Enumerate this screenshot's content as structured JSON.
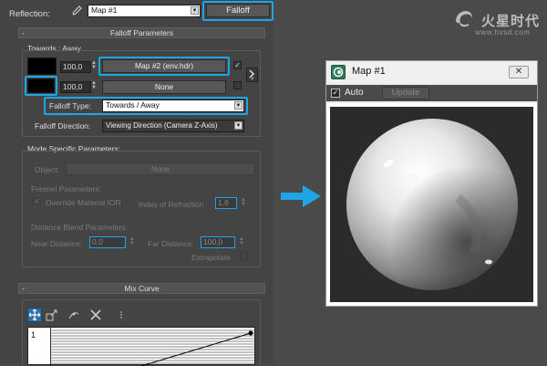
{
  "reflection": {
    "label": "Reflection:",
    "map_select": "Map #1",
    "falloff_button": "Falloff"
  },
  "falloff_params": {
    "rollout_title": "Falloff Parameters",
    "group_label": "Towards : Away",
    "row1_value": "100,0",
    "row1_map": "Map #2 (env.hdr)",
    "row1_checked": "✓",
    "row2_value": "100,0",
    "row2_map": "None",
    "falloff_type_label": "Falloff Type:",
    "falloff_type_value": "Towards / Away",
    "falloff_direction_label": "Falloff Direction:",
    "falloff_direction_value": "Viewing Direction (Camera Z-Axis)"
  },
  "mode_specific": {
    "group_label": "Mode Specific Parameters:",
    "object_label": "Object:",
    "object_button": "None",
    "fresnel_label": "Fresnel Parameters:",
    "override_label": "Override Material IOR",
    "override_checked": "✓",
    "ior_label": "Index of Refraction",
    "ior_value": "1,6",
    "distance_label": "Distance Blend Parameters:",
    "near_label": "Near Distance:",
    "near_value": "0,0",
    "far_label": "Far Distance:",
    "far_value": "100,0",
    "extrapolate_label": "Extrapolate"
  },
  "mix_curve": {
    "rollout_title": "Mix Curve",
    "curve_y_label": "1"
  },
  "map_window": {
    "title": "Map #1",
    "close": "✕",
    "auto_label": "Auto",
    "auto_checked": "✓",
    "update_label": "Update"
  },
  "logo": {
    "text": "火星时代",
    "url": "www.hxsd.com"
  },
  "colors": {
    "highlight": "#1fa4e6",
    "arrow": "#1fa4e6",
    "panel_bg": "#444444",
    "page_bg": "#4a4a4a"
  },
  "icons": [
    "eyedropper-icon",
    "swap-icon",
    "map-app-icon",
    "close-icon",
    "arrow-right-icon",
    "curve-tool-icons",
    "logo-mark-icon"
  ]
}
